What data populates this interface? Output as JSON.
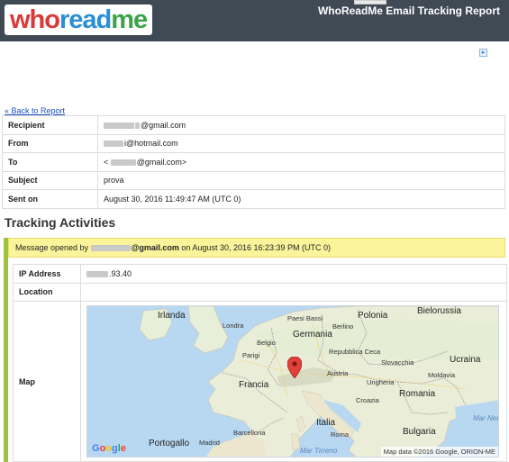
{
  "header": {
    "logo_parts": [
      "who",
      "read",
      "me"
    ],
    "title": "WhoReadMe Email Tracking Report"
  },
  "ad": {
    "icon": "adchoices-icon"
  },
  "nav": {
    "back_link": "« Back to Report"
  },
  "email_info": [
    {
      "label": "Recipient",
      "value": "@gmail.com",
      "masked": true
    },
    {
      "label": "From",
      "value": "i@hotmail.com",
      "masked": true
    },
    {
      "label": "To",
      "value_prefix": "<",
      "value": "@gmail.com>",
      "masked": true
    },
    {
      "label": "Subject",
      "value": "prova",
      "masked": false
    },
    {
      "label": "Sent on",
      "value": "August 30, 2016 11:49:47 AM (UTC 0)",
      "masked": false
    }
  ],
  "tracking": {
    "section_title": "Tracking Activities",
    "activity": {
      "prefix": "Message opened by",
      "opener": "@gmail.com",
      "middle": "on",
      "opened_at": "August 30, 2016 16:23:39 PM (UTC 0)",
      "rows": {
        "ip_label": "IP Address",
        "ip_value": ".93.40",
        "location_label": "Location",
        "location_value": "",
        "map_label": "Map"
      }
    }
  },
  "map": {
    "labels": {
      "irlanda": "Irlanda",
      "londra": "Londra",
      "paesi_bassi": "Paesi Bassi",
      "berlino": "Berlino",
      "polonia": "Polonia",
      "bielorussia": "Bielorussia",
      "belgio": "Belgio",
      "germania": "Germania",
      "ucraina": "Ucraina",
      "parigi": "Parigi",
      "repubblica_ceca": "Repubblica Ceca",
      "slovacchia": "Slovacchia",
      "austria": "Austria",
      "moldavia": "Moldavia",
      "francia": "Francia",
      "ungheria": "Ungheria",
      "romania": "Romania",
      "croazia": "Croazia",
      "mar_nero": "Mar Nero",
      "italia": "Italia",
      "bulgaria": "Bulgaria",
      "barcellona": "Barcellona",
      "roma": "Roma",
      "portogallo": "Portogallo",
      "madrid": "Madrid",
      "mar_tirreno": "Mar Tirreno"
    },
    "brand": [
      "G",
      "o",
      "o",
      "g",
      "l",
      "e"
    ],
    "copyright": "Map data ©2016 Google, ORION-ME",
    "colors": {
      "land": "#f1eee4",
      "water": "#b8d8f1",
      "marker": "#e0413a"
    }
  }
}
